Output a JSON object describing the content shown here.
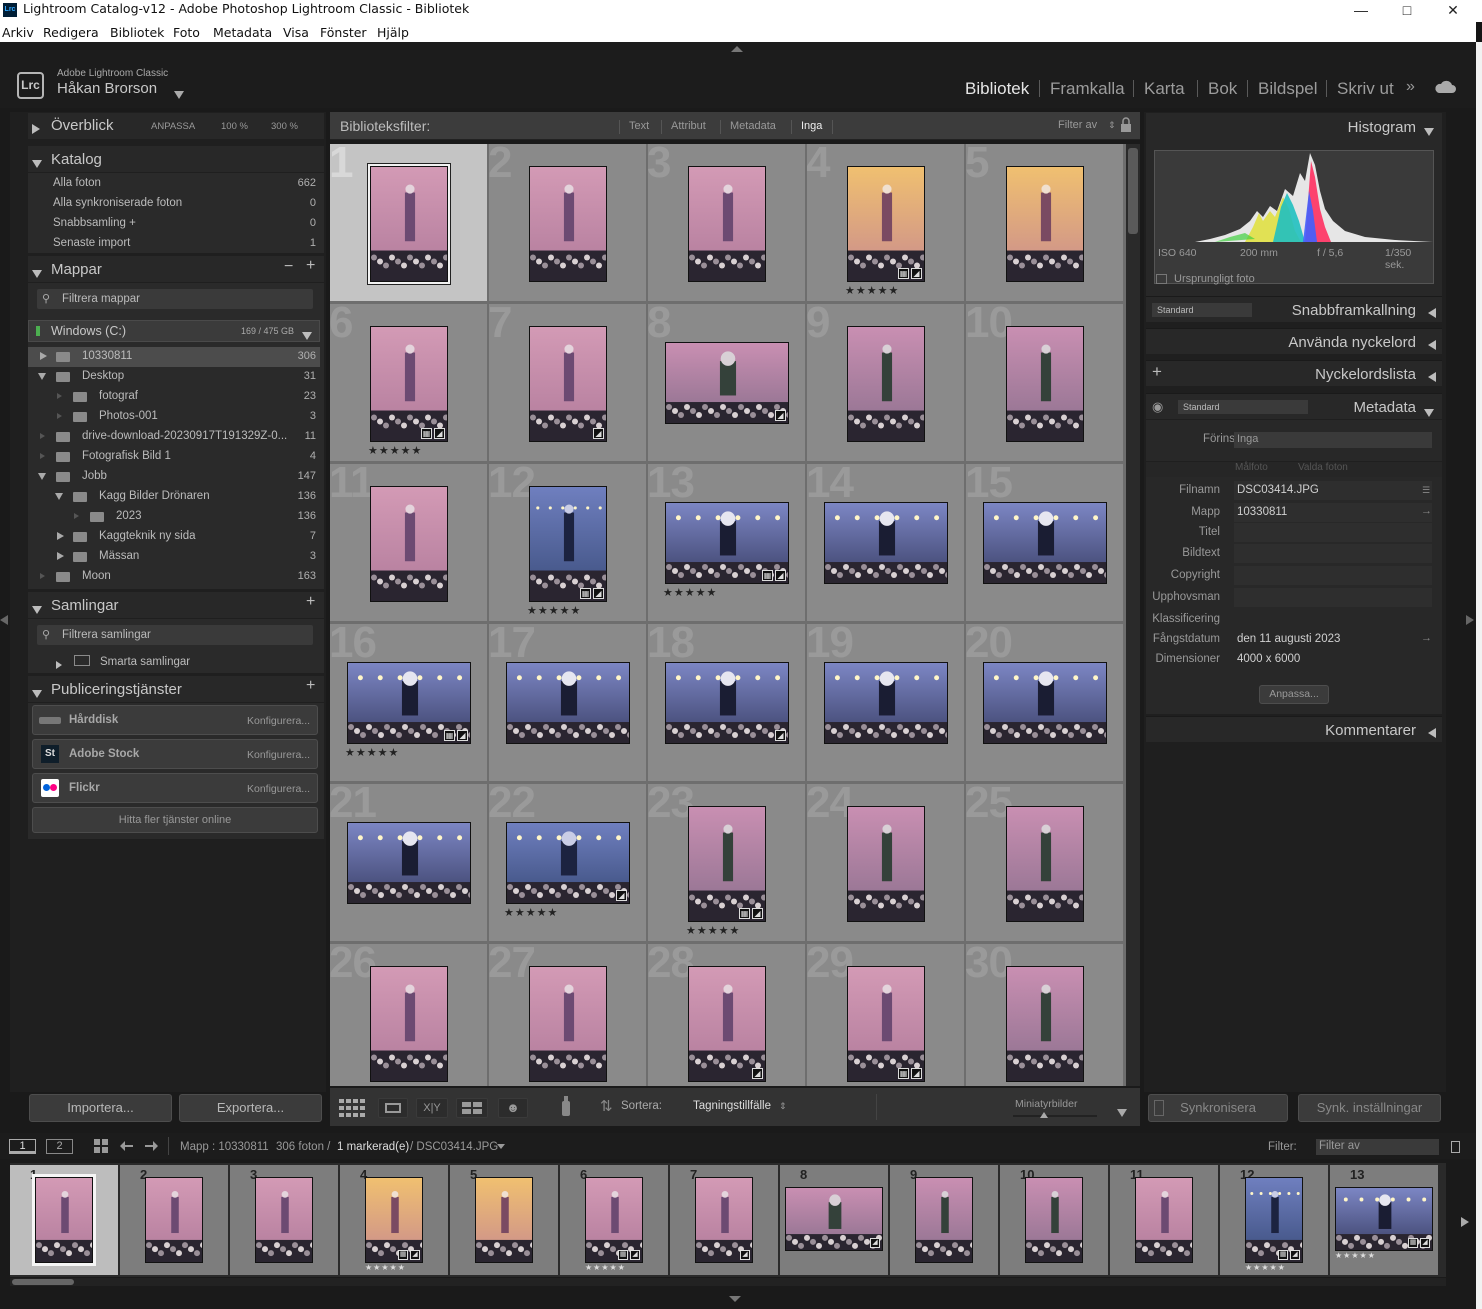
{
  "window": {
    "title": "Lightroom Catalog-v12 - Adobe Photoshop Lightroom Classic - Bibliotek",
    "app_icon": "Lrc"
  },
  "menubar": {
    "items": [
      "Arkiv",
      "Redigera",
      "Bibliotek",
      "Foto",
      "Metadata",
      "Visa",
      "Fönster",
      "Hjälp"
    ]
  },
  "identity": {
    "product": "Adobe Lightroom Classic",
    "user": "Håkan Brorson",
    "logo": "Lrc"
  },
  "modules": [
    "Bibliotek",
    "Framkalla",
    "Karta",
    "Bok",
    "Bildspel",
    "Skriv ut"
  ],
  "active_module": "Bibliotek",
  "navigator": {
    "title": "Överblick",
    "options": [
      "ANPASSA",
      "100 %",
      "300 %"
    ]
  },
  "catalog": {
    "title": "Katalog",
    "items": [
      {
        "label": "Alla foton",
        "count": "662"
      },
      {
        "label": "Alla synkroniserade foton",
        "count": "0"
      },
      {
        "label": "Snabbsamling +",
        "count": "0"
      },
      {
        "label": "Senaste import",
        "count": "1"
      }
    ]
  },
  "folders": {
    "title": "Mappar",
    "filter_placeholder": "Filtrera mappar",
    "volume": {
      "name": "Windows (C:)",
      "usage": "169 / 475 GB"
    },
    "items": [
      {
        "label": "10330811",
        "count": "306",
        "level": 0,
        "expanded": false,
        "selected": true
      },
      {
        "label": "Desktop",
        "count": "31",
        "level": 0,
        "expanded": true
      },
      {
        "label": "fotograf",
        "count": "23",
        "level": 1
      },
      {
        "label": "Photos-001",
        "count": "3",
        "level": 1
      },
      {
        "label": "drive-download-20230917T191329Z-0...",
        "count": "11",
        "level": 0
      },
      {
        "label": "Fotografisk Bild 1",
        "count": "4",
        "level": 0
      },
      {
        "label": "Jobb",
        "count": "147",
        "level": 0,
        "expanded": true
      },
      {
        "label": "Kagg Bilder Drönaren",
        "count": "136",
        "level": 1,
        "expanded": true
      },
      {
        "label": "2023",
        "count": "136",
        "level": 2
      },
      {
        "label": "Kaggteknik ny sida",
        "count": "7",
        "level": 1,
        "expanded": false
      },
      {
        "label": "Mässan",
        "count": "3",
        "level": 1,
        "expanded": false
      },
      {
        "label": "Moon",
        "count": "163",
        "level": 0
      }
    ]
  },
  "collections": {
    "title": "Samlingar",
    "filter_placeholder": "Filtrera samlingar",
    "items": [
      "Smarta samlingar"
    ]
  },
  "publish": {
    "title": "Publiceringstjänster",
    "services": [
      {
        "name": "Hårddisk",
        "action": "Konfigurera..."
      },
      {
        "name": "Adobe Stock",
        "action": "Konfigurera..."
      },
      {
        "name": "Flickr",
        "action": "Konfigurera..."
      }
    ],
    "more": "Hitta fler tjänster online"
  },
  "left_buttons": {
    "import": "Importera...",
    "export": "Exportera..."
  },
  "filterbar": {
    "label": "Biblioteksfilter:",
    "options": [
      "Text",
      "Attribut",
      "Metadata",
      "Inga"
    ],
    "active": "Inga",
    "preset": "Filter av"
  },
  "grid": {
    "cells": [
      {
        "n": "1",
        "orient": "p",
        "sel": true,
        "stars": 0,
        "badges": 0,
        "tone": "pink"
      },
      {
        "n": "2",
        "orient": "p",
        "stars": 0,
        "badges": 0,
        "tone": "pink"
      },
      {
        "n": "3",
        "orient": "p",
        "stars": 0,
        "badges": 0,
        "tone": "pink"
      },
      {
        "n": "4",
        "orient": "p",
        "stars": 5,
        "badges": 2,
        "tone": "pinkbright"
      },
      {
        "n": "5",
        "orient": "p",
        "stars": 0,
        "badges": 0,
        "tone": "pinkbright"
      },
      {
        "n": "6",
        "orient": "p",
        "stars": 5,
        "badges": 2,
        "tone": "pink"
      },
      {
        "n": "7",
        "orient": "p",
        "stars": 0,
        "badges": 1,
        "tone": "pink"
      },
      {
        "n": "8",
        "orient": "l",
        "stars": 0,
        "badges": 1,
        "tone": "stage"
      },
      {
        "n": "9",
        "orient": "p",
        "stars": 0,
        "badges": 0,
        "tone": "stage"
      },
      {
        "n": "10",
        "orient": "p",
        "stars": 0,
        "badges": 0,
        "tone": "stage"
      },
      {
        "n": "11",
        "orient": "p",
        "stars": 0,
        "badges": 0,
        "tone": "pink"
      },
      {
        "n": "12",
        "orient": "p",
        "stars": 5,
        "badges": 2,
        "tone": "blue"
      },
      {
        "n": "13",
        "orient": "l",
        "stars": 5,
        "badges": 2,
        "tone": "crowd"
      },
      {
        "n": "14",
        "orient": "l",
        "stars": 0,
        "badges": 0,
        "tone": "crowd"
      },
      {
        "n": "15",
        "orient": "l",
        "stars": 0,
        "badges": 0,
        "tone": "crowd"
      },
      {
        "n": "16",
        "orient": "l",
        "stars": 5,
        "badges": 2,
        "tone": "crowd"
      },
      {
        "n": "17",
        "orient": "l",
        "stars": 0,
        "badges": 0,
        "tone": "crowd"
      },
      {
        "n": "18",
        "orient": "l",
        "stars": 0,
        "badges": 1,
        "tone": "crowd"
      },
      {
        "n": "19",
        "orient": "l",
        "stars": 0,
        "badges": 0,
        "tone": "crowd"
      },
      {
        "n": "20",
        "orient": "l",
        "stars": 0,
        "badges": 0,
        "tone": "crowd"
      },
      {
        "n": "21",
        "orient": "l",
        "stars": 0,
        "badges": 0,
        "tone": "crowd"
      },
      {
        "n": "22",
        "orient": "l",
        "stars": 5,
        "badges": 1,
        "tone": "blue"
      },
      {
        "n": "23",
        "orient": "p",
        "stars": 5,
        "badges": 2,
        "tone": "stage"
      },
      {
        "n": "24",
        "orient": "p",
        "stars": 0,
        "badges": 0,
        "tone": "stage"
      },
      {
        "n": "25",
        "orient": "p",
        "stars": 0,
        "badges": 0,
        "tone": "stage"
      },
      {
        "n": "26",
        "orient": "p",
        "stars": 0,
        "badges": 0,
        "tone": "pink"
      },
      {
        "n": "27",
        "orient": "p",
        "stars": 0,
        "badges": 0,
        "tone": "pink"
      },
      {
        "n": "28",
        "orient": "p",
        "stars": 0,
        "badges": 1,
        "tone": "pink"
      },
      {
        "n": "29",
        "orient": "p",
        "stars": 0,
        "badges": 2,
        "tone": "pink"
      },
      {
        "n": "30",
        "orient": "p",
        "stars": 0,
        "badges": 0,
        "tone": "stage"
      }
    ]
  },
  "toolbar": {
    "sort_label": "Sortera:",
    "sort_value": "Tagningstillfälle",
    "thumb_label": "Miniatyrbilder"
  },
  "histogram": {
    "title": "Histogram",
    "iso": "ISO 640",
    "focal": "200 mm",
    "aperture": "f / 5,6",
    "shutter": "1/350 sek.",
    "original_label": "Ursprungligt foto"
  },
  "quick_develop": {
    "preset": "Standard",
    "title": "Snabbframkallning"
  },
  "keywording": {
    "title": "Använda nyckelord"
  },
  "keyword_list": {
    "title": "Nyckelordslista"
  },
  "metadata": {
    "preset": "Standard",
    "title": "Metadata",
    "preset_label": "Förinst.",
    "preset_value": "Inga",
    "tabs": [
      "Målfoto",
      "Valda foton"
    ],
    "fields": [
      {
        "key": "Filnamn",
        "value": "DSC03414.JPG"
      },
      {
        "key": "Mapp",
        "value": "10330811"
      },
      {
        "key": "Titel",
        "value": ""
      },
      {
        "key": "Bildtext",
        "value": ""
      },
      {
        "key": "Copyright",
        "value": ""
      },
      {
        "key": "Upphovsman",
        "value": ""
      },
      {
        "key": "Klassificering",
        "value": ""
      },
      {
        "key": "Fångstdatum",
        "value": "den 11 augusti 2023"
      },
      {
        "key": "Dimensioner",
        "value": "4000 x 6000"
      }
    ],
    "customize": "Anpassa..."
  },
  "comments": {
    "title": "Kommentarer"
  },
  "right_buttons": {
    "sync": "Synkronisera",
    "sync_settings": "Synk. inställningar"
  },
  "filmstrip_bar": {
    "page1": "1",
    "page2": "2",
    "path": "Mapp : 10330811",
    "count": "306 foton /",
    "selected": "1 markerad(e)",
    "file": "/ DSC03414.JPG",
    "filter_label": "Filter:",
    "filter_value": "Filter av"
  },
  "filmstrip": {
    "cells": [
      {
        "n": "1",
        "orient": "p",
        "sel": true,
        "stars": 0,
        "badges": 0,
        "tone": "pink"
      },
      {
        "n": "2",
        "orient": "p",
        "stars": 0,
        "badges": 0,
        "tone": "pink"
      },
      {
        "n": "3",
        "orient": "p",
        "stars": 0,
        "badges": 0,
        "tone": "pink"
      },
      {
        "n": "4",
        "orient": "p",
        "stars": 5,
        "badges": 2,
        "tone": "pinkbright"
      },
      {
        "n": "5",
        "orient": "p",
        "stars": 0,
        "badges": 0,
        "tone": "pinkbright"
      },
      {
        "n": "6",
        "orient": "p",
        "stars": 5,
        "badges": 2,
        "tone": "pink"
      },
      {
        "n": "7",
        "orient": "p",
        "stars": 0,
        "badges": 1,
        "tone": "pink"
      },
      {
        "n": "8",
        "orient": "l",
        "stars": 0,
        "badges": 1,
        "tone": "stage"
      },
      {
        "n": "9",
        "orient": "p",
        "stars": 0,
        "badges": 0,
        "tone": "stage"
      },
      {
        "n": "10",
        "orient": "p",
        "stars": 0,
        "badges": 0,
        "tone": "stage"
      },
      {
        "n": "11",
        "orient": "p",
        "stars": 0,
        "badges": 0,
        "tone": "pink"
      },
      {
        "n": "12",
        "orient": "p",
        "stars": 5,
        "badges": 2,
        "tone": "blue"
      },
      {
        "n": "13",
        "orient": "l",
        "stars": 5,
        "badges": 2,
        "tone": "crowd"
      }
    ]
  },
  "colors": {
    "panel": "#282828",
    "grid_cell": "#8a8a8a",
    "selected_cell": "#c4c4c4",
    "text": "#c8c8c8"
  }
}
